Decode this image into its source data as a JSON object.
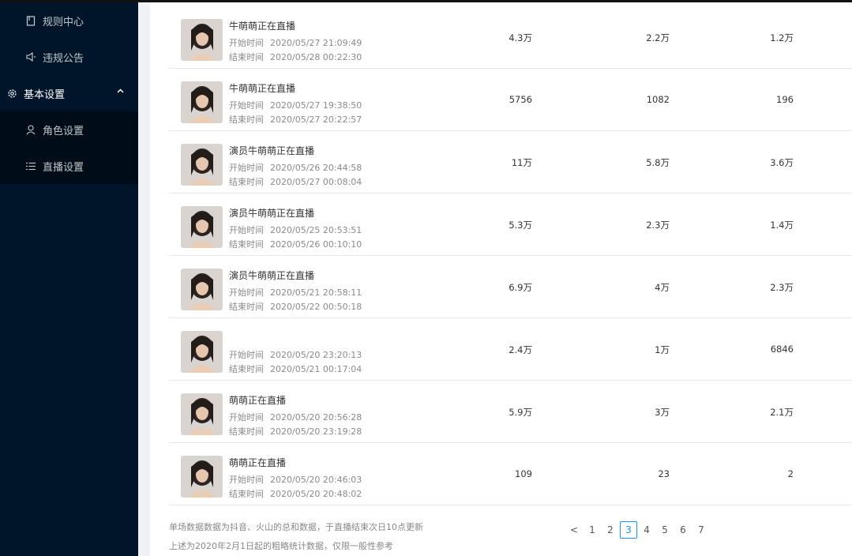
{
  "sidebar": {
    "items": [
      {
        "label": "规则中心",
        "icon": "book-icon"
      },
      {
        "label": "违规公告",
        "icon": "speaker-icon"
      }
    ],
    "group": {
      "label": "基本设置",
      "icon": "gear-icon",
      "expanded": true
    },
    "sub_items": [
      {
        "label": "角色设置",
        "icon": "user-icon"
      },
      {
        "label": "直播设置",
        "icon": "list-icon"
      }
    ]
  },
  "table": {
    "rows": [
      {
        "title": "牛萌萌正在直播",
        "start_label": "开始时间",
        "start": "2020/05/27 21:09:49",
        "end_label": "结束时间",
        "end": "2020/05/28 00:22:30",
        "v1": "4.3万",
        "v2": "2.2万",
        "v3": "1.2万"
      },
      {
        "title": "牛萌萌正在直播",
        "start_label": "开始时间",
        "start": "2020/05/27 19:38:50",
        "end_label": "结束时间",
        "end": "2020/05/27 20:22:57",
        "v1": "5756",
        "v2": "1082",
        "v3": "196"
      },
      {
        "title": "演员牛萌萌正在直播",
        "start_label": "开始时间",
        "start": "2020/05/26 20:44:58",
        "end_label": "结束时间",
        "end": "2020/05/27 00:08:04",
        "v1": "11万",
        "v2": "5.8万",
        "v3": "3.6万"
      },
      {
        "title": "演员牛萌萌正在直播",
        "start_label": "开始时间",
        "start": "2020/05/25 20:53:51",
        "end_label": "结束时间",
        "end": "2020/05/26 00:10:10",
        "v1": "5.3万",
        "v2": "2.3万",
        "v3": "1.4万"
      },
      {
        "title": "演员牛萌萌正在直播",
        "start_label": "开始时间",
        "start": "2020/05/21 20:58:11",
        "end_label": "结束时间",
        "end": "2020/05/22 00:50:18",
        "v1": "6.9万",
        "v2": "4万",
        "v3": "2.3万"
      },
      {
        "title": "",
        "start_label": "开始时间",
        "start": "2020/05/20 23:20:13",
        "end_label": "结束时间",
        "end": "2020/05/21 00:17:04",
        "v1": "2.4万",
        "v2": "1万",
        "v3": "6846"
      },
      {
        "title": "萌萌正在直播",
        "start_label": "开始时间",
        "start": "2020/05/20 20:56:28",
        "end_label": "结束时间",
        "end": "2020/05/20 23:19:28",
        "v1": "5.9万",
        "v2": "3万",
        "v3": "2.1万"
      },
      {
        "title": "萌萌正在直播",
        "start_label": "开始时间",
        "start": "2020/05/20 20:46:03",
        "end_label": "结束时间",
        "end": "2020/05/20 20:48:02",
        "v1": "109",
        "v2": "23",
        "v3": "2"
      }
    ]
  },
  "footer": {
    "note1": "单场数据数据为抖音、火山的总和数据，于直播结束次日10点更新",
    "note2": "上述为2020年2月1日起的粗略统计数据，仅限一般性参考"
  },
  "pagination": {
    "prev": "<",
    "pages": [
      "1",
      "2",
      "3",
      "4",
      "5",
      "6",
      "7"
    ],
    "current": "3"
  },
  "colors": {
    "sidebar_bg": "#001529",
    "submenu_bg": "#000c17",
    "accent": "#1890ff"
  }
}
